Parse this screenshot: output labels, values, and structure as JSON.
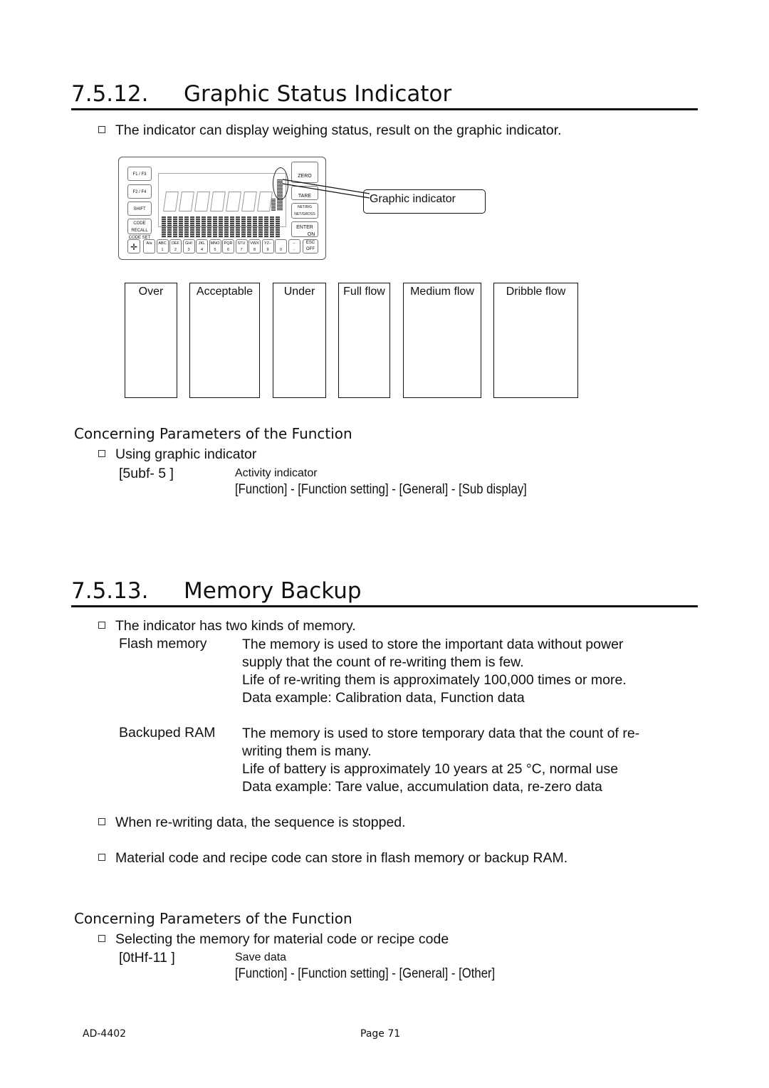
{
  "section1": {
    "number": "7.5.12.",
    "title": "Graphic Status Indicator",
    "intro": "The indicator can display weighing status, result on the graphic indicator.",
    "callout": "Graphic indicator",
    "panel_keys": {
      "f1": "F1 / F3",
      "f2": "F2 / F4",
      "shift": "SHIFT",
      "code1": "CODE RECALL",
      "code2": "CODE SET",
      "zero": "ZERO",
      "tare": "TARE",
      "net1": "NET/B/G",
      "net2": "NET/GROSS",
      "enter": "ENTER",
      "on": "ON",
      "esc": "ESC",
      "off": "OFF",
      "alpha": [
        [
          "A/a",
          ""
        ],
        [
          "ABC",
          "1"
        ],
        [
          "DEF",
          "2"
        ],
        [
          "GHI",
          "3"
        ],
        [
          "JKL",
          "4"
        ],
        [
          "MNO",
          "5"
        ],
        [
          "PQR",
          "6"
        ],
        [
          "STU",
          "7"
        ],
        [
          "VWX",
          "8"
        ],
        [
          "YZ–",
          "9"
        ],
        [
          "",
          "0"
        ],
        [
          "–",
          "-"
        ]
      ]
    },
    "status_boxes": [
      "Over",
      "Acceptable",
      "Under",
      "Full flow",
      "Medium flow",
      "Dribble flow"
    ],
    "params_heading": "Concerning Parameters of the Function",
    "param_item": "Using graphic indicator",
    "param_code": "[5ubf- 5   ]",
    "param_name": "Activity indicator",
    "param_path": "[Function] - [Function setting] - [General] - [Sub display]"
  },
  "section2": {
    "number": "7.5.13.",
    "title": "Memory Backup",
    "intro": "The indicator has two kinds of memory.",
    "flash_label": "Flash memory",
    "flash_lines": [
      "The memory is used to store the important data without power",
      "supply that the count of re-writing them is few.",
      "Life of re-writing them is approximately 100,000 times or more.",
      "Data example: Calibration data, Function data"
    ],
    "ram_label": "Backuped RAM",
    "ram_lines": [
      "The memory is used to store temporary data that the count of re-",
      "writing them is many.",
      "Life of battery is approximately 10 years at 25 °C, normal use",
      "Data example: Tare value, accumulation data, re-zero data"
    ],
    "note1": "When re-writing data, the sequence is stopped.",
    "note2": "Material code and recipe code can store in flash memory or backup RAM.",
    "params_heading": "Concerning Parameters of the Function",
    "param_item": "Selecting the memory for material code or recipe code",
    "param_code": "[0tHf-11  ]",
    "param_name": "Save data",
    "param_path": "[Function] - [Function setting] - [General] - [Other]"
  },
  "footer": {
    "model": "AD-4402",
    "page": "Page 71"
  }
}
